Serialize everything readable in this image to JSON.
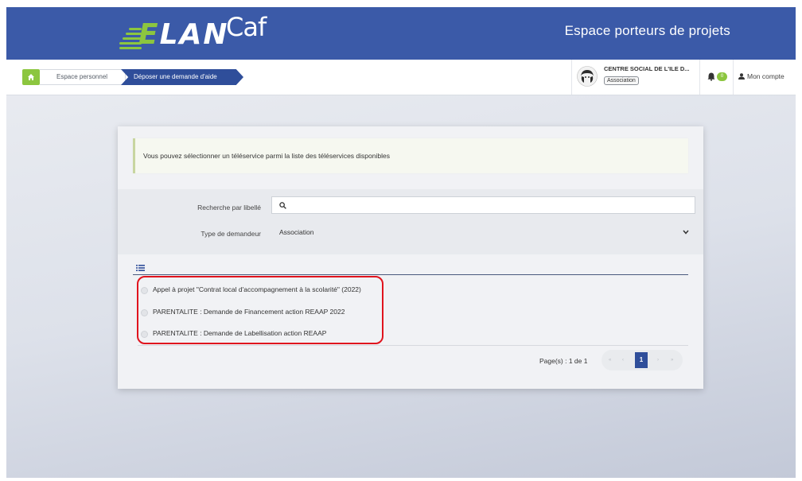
{
  "header": {
    "logo": {
      "part1": "E",
      "part2": "LAN",
      "part3": "Caf"
    },
    "title": "Espace porteurs de projets"
  },
  "breadcrumb": {
    "home_icon": "home-icon",
    "items": [
      {
        "label": "Espace personnel"
      },
      {
        "label": "Déposer une demande d'aide"
      }
    ]
  },
  "user": {
    "org_name": "CENTRE SOCIAL DE L'ILE D...",
    "org_type": "Association",
    "notification_count": "0",
    "account_label": "Mon compte"
  },
  "main": {
    "info_message": "Vous pouvez sélectionner un téléservice parmi la liste des téléservices disponibles",
    "search": {
      "label": "Recherche par libellé",
      "value": "",
      "placeholder": ""
    },
    "requester_type": {
      "label": "Type de demandeur",
      "selected": "Association"
    },
    "services": [
      {
        "label": "Appel à projet \"Contrat local d'accompagnement à la scolarité\" (2022)"
      },
      {
        "label": "PARENTALITE : Demande de Financement action REAAP 2022"
      },
      {
        "label": "PARENTALITE : Demande de Labellisation action REAAP"
      }
    ],
    "pagination": {
      "label": "Page(s) : 1 de 1",
      "first": "«",
      "prev": "‹",
      "current": "1",
      "next": "›",
      "last": "»"
    }
  },
  "colors": {
    "header_bg": "#3b5aa8",
    "accent_green": "#8cc63f",
    "breadcrumb_active": "#2f4e9a",
    "highlight_red": "#e0141e"
  }
}
